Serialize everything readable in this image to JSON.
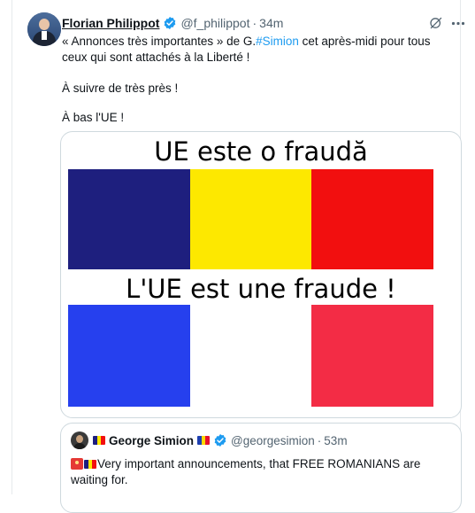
{
  "tweet": {
    "author_name": "Florian Philippot",
    "handle": "@f_philippot",
    "separator": "·",
    "time": "34m",
    "line1_prefix": "« Annonces très importantes » de G.",
    "line1_hashtag": "#Simion",
    "line1_suffix": " cet après-midi pour tous",
    "line2": "ceux qui sont attachés à la Liberté !",
    "line3": "À suivre de très près !",
    "line4": "À bas l'UE !"
  },
  "media": {
    "caption_top": "UE este o fraudă",
    "caption_bottom": "L'UE est une fraude !",
    "romania_flag": [
      "#1e1f7e",
      "#fde800",
      "#f20f0f"
    ],
    "france_flag": [
      "#2640ee",
      "#ffffff",
      "#f32c45"
    ]
  },
  "quote": {
    "author_name": "George Simion",
    "handle": "@georgesimion",
    "separator": "·",
    "time": "53m",
    "line1": "Very important announcements, that FREE ROMANIANS are",
    "line2": "waiting for."
  },
  "colors": {
    "verified_blue": "#1d9bf0",
    "secondary_text": "#536471",
    "link": "#1d9bf0"
  },
  "icons": [
    "verified-badge-icon",
    "grok-icon",
    "more-icon",
    "siren-emoji-icon",
    "romania-flag-emoji-icon",
    "moldova-flag-emoji-icon"
  ]
}
